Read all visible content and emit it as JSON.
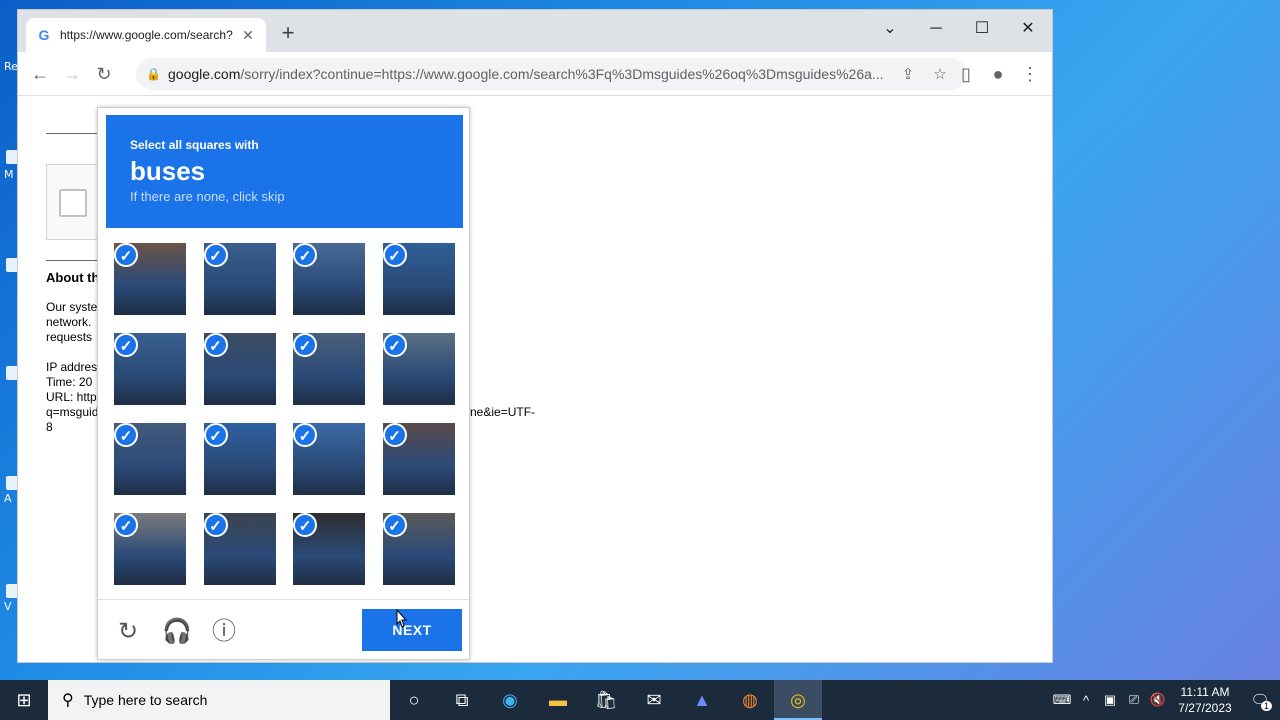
{
  "desktop": {
    "labels": [
      "Re",
      "M",
      "A",
      "V"
    ]
  },
  "browser": {
    "tab_title": "https://www.google.com/search?",
    "tab_favicon": "G",
    "url_host": "google.com",
    "url_rest": "/sorry/index?continue=https://www.google.com/search%3Fq%3Dmsguides%26oq%3Dmsguides%26a..."
  },
  "page": {
    "about_heading": "About th",
    "body_lines": "Our syste network. requests",
    "info_lines": [
      "IP addres",
      "Time: 20",
      "URL: http",
      "q=msguid",
      "8"
    ],
    "url_tail": "ne&ie=UTF-"
  },
  "captcha": {
    "instruction": "Select all squares with",
    "target": "buses",
    "subtext": "If there are none, click skip",
    "next_label": "NEXT",
    "tiles_selected": [
      true,
      true,
      true,
      true,
      true,
      true,
      true,
      true,
      true,
      true,
      true,
      true,
      true,
      true,
      true,
      true
    ]
  },
  "taskbar": {
    "search_placeholder": "Type here to search",
    "time": "11:11 AM",
    "date": "7/27/2023",
    "notification_count": "1"
  }
}
